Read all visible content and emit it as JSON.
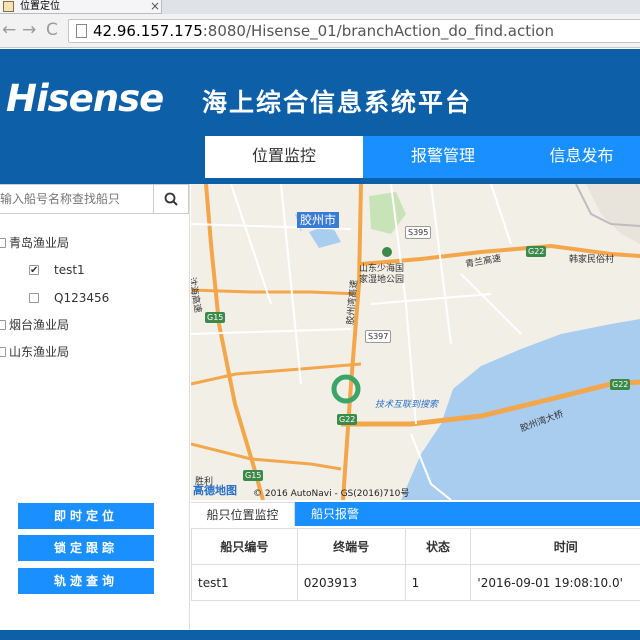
{
  "browser": {
    "tab_title": "位置定位",
    "tab_close": "×",
    "url_host": "42.96.157.175",
    "url_rest": ":8080/Hisense_01/branchAction_do_find.action",
    "back": "←",
    "forward": "→",
    "reload": "C"
  },
  "header": {
    "logo": "Hisense",
    "system_title": "海上综合信息系统平台"
  },
  "nav": {
    "items": [
      {
        "label": "位置监控"
      },
      {
        "label": "报警管理"
      },
      {
        "label": "信息发布"
      }
    ]
  },
  "sidebar": {
    "search_placeholder": "输入船号名称查找船只",
    "tree": [
      {
        "label": "青岛渔业局"
      },
      {
        "label": "test1"
      },
      {
        "label": "Q123456"
      },
      {
        "label": "烟台渔业局"
      },
      {
        "label": "山东渔业局"
      }
    ],
    "buttons": [
      {
        "label": "即时定位"
      },
      {
        "label": "锁定跟踪"
      },
      {
        "label": "轨迹查询"
      }
    ]
  },
  "map": {
    "city": "胶州市",
    "labels": {
      "park": "山东少海国\n家湿地公园",
      "qinglan": "青兰高速",
      "hanjia": "韩家民俗村",
      "bridge": "胶州湾大桥",
      "shenhai": "沈海高速",
      "jiaozhou_bay": "胶州湾高速",
      "shengli": "胜利",
      "watermark": "技术互联到搜索"
    },
    "roads": {
      "s395": "S395",
      "g22a": "G22",
      "g15a": "G15",
      "s397": "S397",
      "g22b": "G22",
      "g22c": "G22",
      "g15b": "G15"
    },
    "logo": "高德地图",
    "copyright": "© 2016 AutoNavi - GS(2016)710号"
  },
  "bottom": {
    "tabs": [
      {
        "label": "船只位置监控"
      },
      {
        "label": "船只报警"
      }
    ],
    "table": {
      "headers": [
        "船只编号",
        "终端号",
        "状态",
        "时间"
      ],
      "rows": [
        [
          "test1",
          "0203913",
          "1",
          "'2016-09-01 19:08:10.0'"
        ]
      ]
    }
  },
  "colors": {
    "brand": "#0d5fa8",
    "accent": "#1a8fff"
  }
}
